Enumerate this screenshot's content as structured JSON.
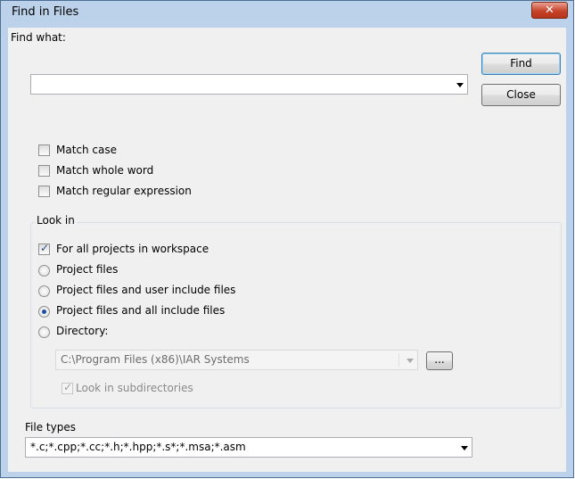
{
  "window": {
    "title": "Find in Files",
    "close_glyph": "✕"
  },
  "find_what": {
    "label": "Find what:",
    "value": ""
  },
  "buttons": {
    "find": "Find",
    "close": "Close"
  },
  "options": [
    {
      "label": "Match case",
      "checked": false
    },
    {
      "label": "Match whole word",
      "checked": false
    },
    {
      "label": "Match regular expression",
      "checked": false
    }
  ],
  "look_in": {
    "title": "Look in",
    "all_projects": {
      "label": "For all projects in workspace",
      "checked": true
    },
    "radios": [
      {
        "label": "Project files",
        "selected": false
      },
      {
        "label": "Project files and user include files",
        "selected": false
      },
      {
        "label": "Project files and all include files",
        "selected": true
      },
      {
        "label": "Directory:",
        "selected": false
      }
    ],
    "directory_value": "C:\\Program Files (x86)\\IAR Systems",
    "browse_label": "...",
    "subdirs": {
      "label": "Look in subdirectories",
      "checked": true,
      "enabled": false
    }
  },
  "file_types": {
    "label": "File types",
    "value": "*.c;*.cpp;*.cc;*.h;*.hpp;*.s*;*.msa;*.asm"
  },
  "colors": {
    "frame": "#bcd2ea",
    "client": "#f0f0f0",
    "close_button": "#c7432b",
    "radio_dot": "#1d4ea3"
  }
}
